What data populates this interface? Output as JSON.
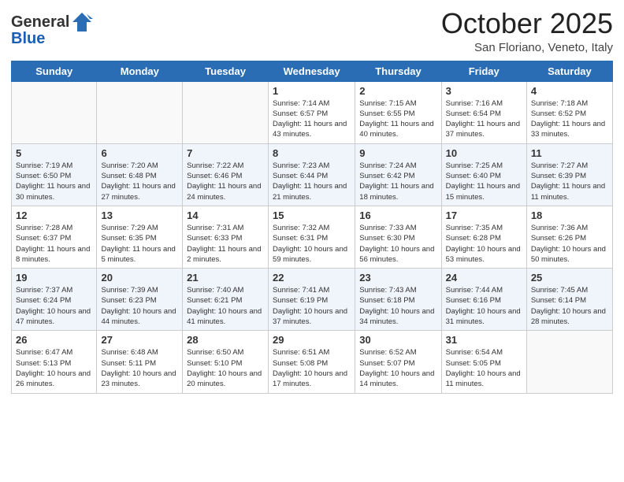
{
  "header": {
    "logo_general": "General",
    "logo_blue": "Blue",
    "month_title": "October 2025",
    "location": "San Floriano, Veneto, Italy"
  },
  "days_of_week": [
    "Sunday",
    "Monday",
    "Tuesday",
    "Wednesday",
    "Thursday",
    "Friday",
    "Saturday"
  ],
  "weeks": [
    [
      {
        "day": "",
        "info": ""
      },
      {
        "day": "",
        "info": ""
      },
      {
        "day": "",
        "info": ""
      },
      {
        "day": "1",
        "info": "Sunrise: 7:14 AM\nSunset: 6:57 PM\nDaylight: 11 hours and 43 minutes."
      },
      {
        "day": "2",
        "info": "Sunrise: 7:15 AM\nSunset: 6:55 PM\nDaylight: 11 hours and 40 minutes."
      },
      {
        "day": "3",
        "info": "Sunrise: 7:16 AM\nSunset: 6:54 PM\nDaylight: 11 hours and 37 minutes."
      },
      {
        "day": "4",
        "info": "Sunrise: 7:18 AM\nSunset: 6:52 PM\nDaylight: 11 hours and 33 minutes."
      }
    ],
    [
      {
        "day": "5",
        "info": "Sunrise: 7:19 AM\nSunset: 6:50 PM\nDaylight: 11 hours and 30 minutes."
      },
      {
        "day": "6",
        "info": "Sunrise: 7:20 AM\nSunset: 6:48 PM\nDaylight: 11 hours and 27 minutes."
      },
      {
        "day": "7",
        "info": "Sunrise: 7:22 AM\nSunset: 6:46 PM\nDaylight: 11 hours and 24 minutes."
      },
      {
        "day": "8",
        "info": "Sunrise: 7:23 AM\nSunset: 6:44 PM\nDaylight: 11 hours and 21 minutes."
      },
      {
        "day": "9",
        "info": "Sunrise: 7:24 AM\nSunset: 6:42 PM\nDaylight: 11 hours and 18 minutes."
      },
      {
        "day": "10",
        "info": "Sunrise: 7:25 AM\nSunset: 6:40 PM\nDaylight: 11 hours and 15 minutes."
      },
      {
        "day": "11",
        "info": "Sunrise: 7:27 AM\nSunset: 6:39 PM\nDaylight: 11 hours and 11 minutes."
      }
    ],
    [
      {
        "day": "12",
        "info": "Sunrise: 7:28 AM\nSunset: 6:37 PM\nDaylight: 11 hours and 8 minutes."
      },
      {
        "day": "13",
        "info": "Sunrise: 7:29 AM\nSunset: 6:35 PM\nDaylight: 11 hours and 5 minutes."
      },
      {
        "day": "14",
        "info": "Sunrise: 7:31 AM\nSunset: 6:33 PM\nDaylight: 11 hours and 2 minutes."
      },
      {
        "day": "15",
        "info": "Sunrise: 7:32 AM\nSunset: 6:31 PM\nDaylight: 10 hours and 59 minutes."
      },
      {
        "day": "16",
        "info": "Sunrise: 7:33 AM\nSunset: 6:30 PM\nDaylight: 10 hours and 56 minutes."
      },
      {
        "day": "17",
        "info": "Sunrise: 7:35 AM\nSunset: 6:28 PM\nDaylight: 10 hours and 53 minutes."
      },
      {
        "day": "18",
        "info": "Sunrise: 7:36 AM\nSunset: 6:26 PM\nDaylight: 10 hours and 50 minutes."
      }
    ],
    [
      {
        "day": "19",
        "info": "Sunrise: 7:37 AM\nSunset: 6:24 PM\nDaylight: 10 hours and 47 minutes."
      },
      {
        "day": "20",
        "info": "Sunrise: 7:39 AM\nSunset: 6:23 PM\nDaylight: 10 hours and 44 minutes."
      },
      {
        "day": "21",
        "info": "Sunrise: 7:40 AM\nSunset: 6:21 PM\nDaylight: 10 hours and 41 minutes."
      },
      {
        "day": "22",
        "info": "Sunrise: 7:41 AM\nSunset: 6:19 PM\nDaylight: 10 hours and 37 minutes."
      },
      {
        "day": "23",
        "info": "Sunrise: 7:43 AM\nSunset: 6:18 PM\nDaylight: 10 hours and 34 minutes."
      },
      {
        "day": "24",
        "info": "Sunrise: 7:44 AM\nSunset: 6:16 PM\nDaylight: 10 hours and 31 minutes."
      },
      {
        "day": "25",
        "info": "Sunrise: 7:45 AM\nSunset: 6:14 PM\nDaylight: 10 hours and 28 minutes."
      }
    ],
    [
      {
        "day": "26",
        "info": "Sunrise: 6:47 AM\nSunset: 5:13 PM\nDaylight: 10 hours and 26 minutes."
      },
      {
        "day": "27",
        "info": "Sunrise: 6:48 AM\nSunset: 5:11 PM\nDaylight: 10 hours and 23 minutes."
      },
      {
        "day": "28",
        "info": "Sunrise: 6:50 AM\nSunset: 5:10 PM\nDaylight: 10 hours and 20 minutes."
      },
      {
        "day": "29",
        "info": "Sunrise: 6:51 AM\nSunset: 5:08 PM\nDaylight: 10 hours and 17 minutes."
      },
      {
        "day": "30",
        "info": "Sunrise: 6:52 AM\nSunset: 5:07 PM\nDaylight: 10 hours and 14 minutes."
      },
      {
        "day": "31",
        "info": "Sunrise: 6:54 AM\nSunset: 5:05 PM\nDaylight: 10 hours and 11 minutes."
      },
      {
        "day": "",
        "info": ""
      }
    ]
  ]
}
